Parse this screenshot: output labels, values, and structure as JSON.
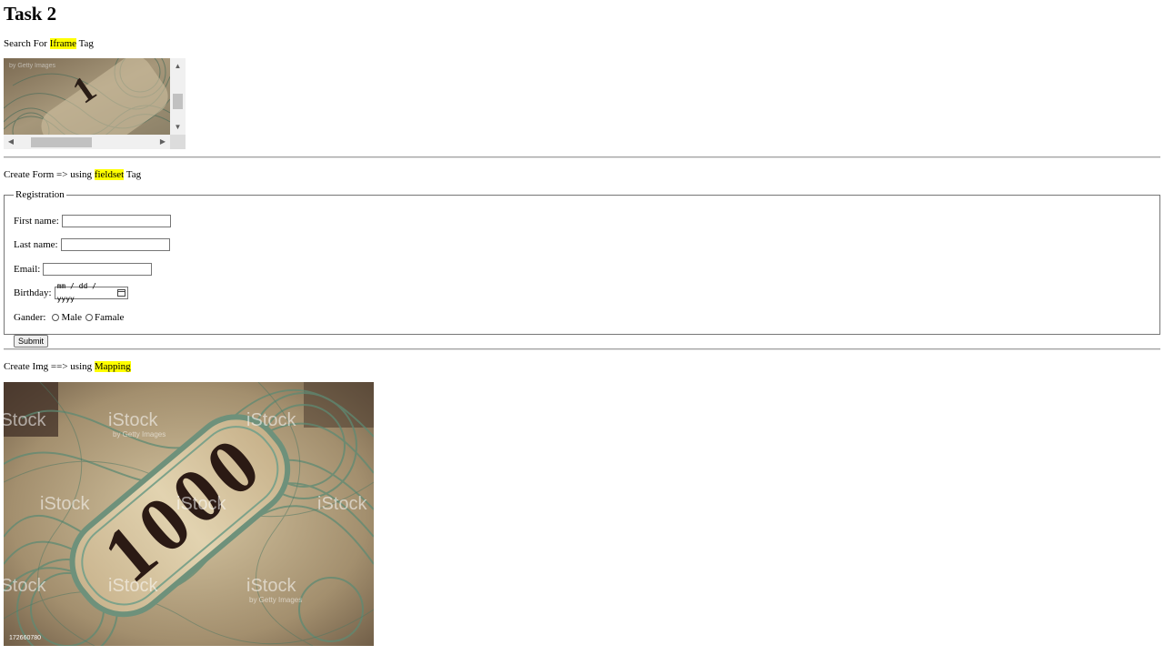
{
  "page": {
    "title": "Task 2"
  },
  "section_iframe": {
    "prefix": "Search For ",
    "highlight": "Iframe",
    "suffix": " Tag",
    "iframe_watermark": "by Getty Images"
  },
  "section_form": {
    "prefix": "Create Form => using ",
    "highlight": "fieldset",
    "suffix": " Tag",
    "legend": "Registration",
    "first_name_label": "First name:",
    "last_name_label": "Last name:",
    "email_label": "Email:",
    "birthday_label": "Birthday:",
    "birthday_placeholder": "mm / dd / yyyy",
    "gender_label": "Gander:",
    "gender_options": [
      "Male",
      "Famale"
    ],
    "submit_label": "Submit"
  },
  "section_map": {
    "prefix": "Create Img ==> using ",
    "highlight": "Mapping",
    "image": {
      "watermark": "iStock",
      "watermark_sub": "by Getty Images",
      "banknote_text": "1000",
      "stock_id": "172660780"
    }
  },
  "colors": {
    "highlight": "#ffff00",
    "note_green": "#6b8f78",
    "note_cream": "#d9c8a4"
  }
}
